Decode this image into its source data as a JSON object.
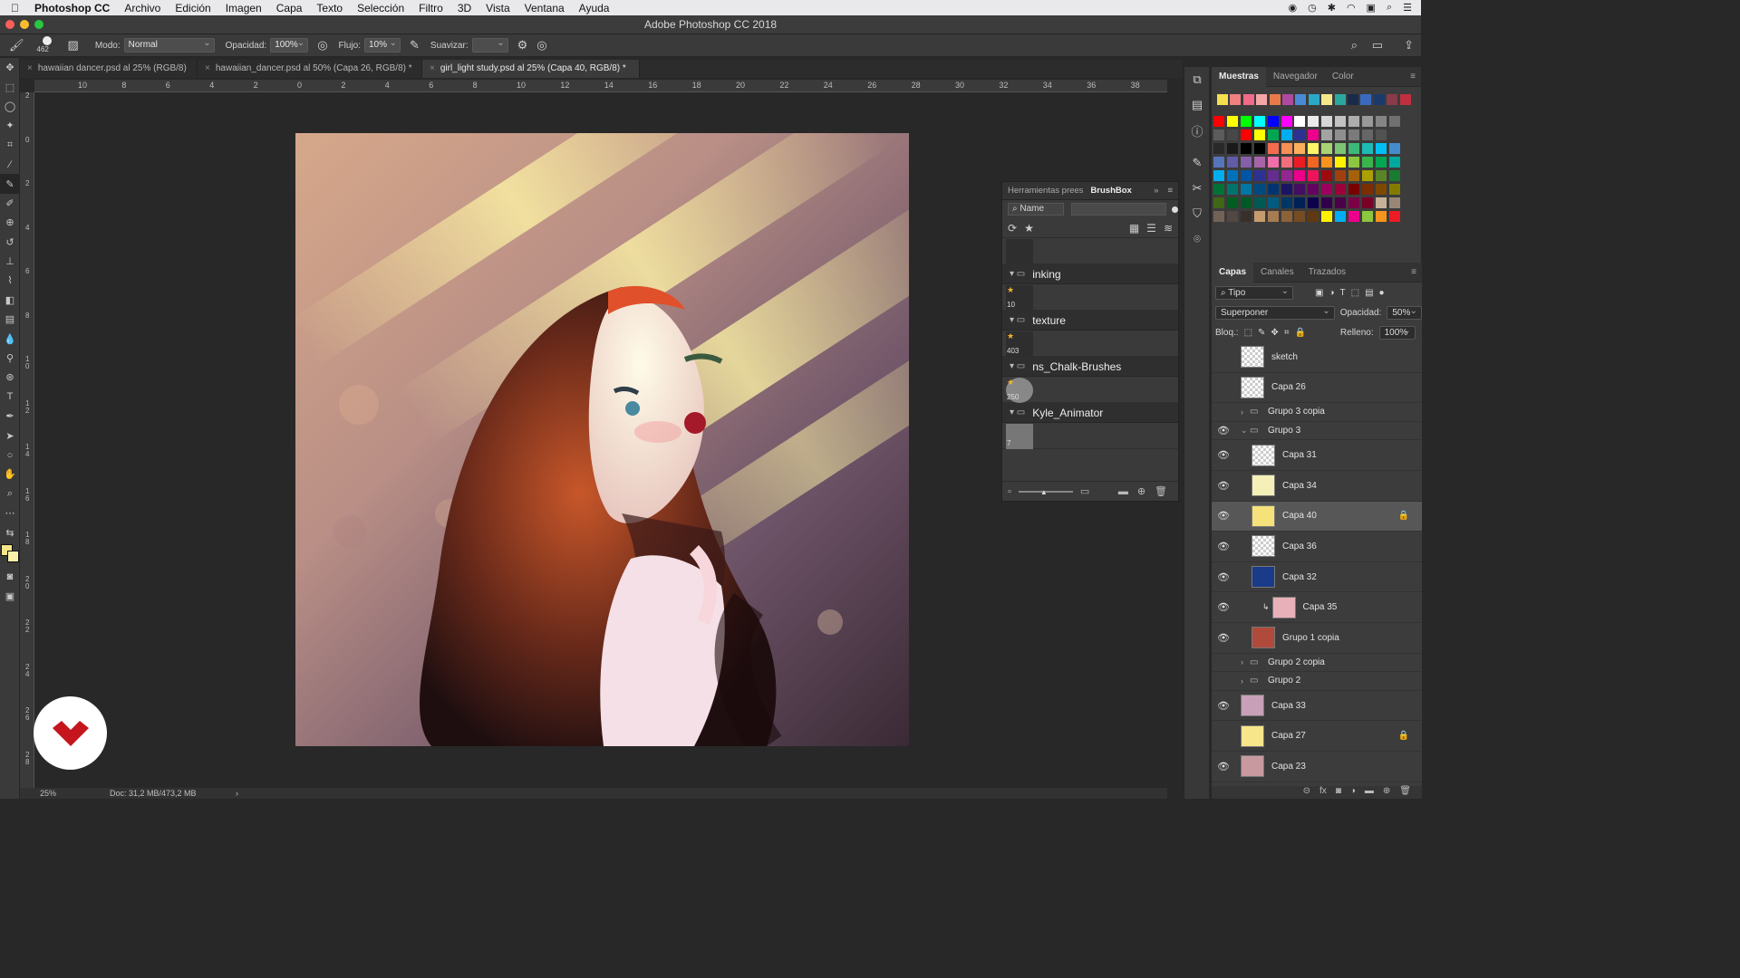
{
  "menubar": {
    "app": "Photoshop CC",
    "items": [
      "Archivo",
      "Edición",
      "Imagen",
      "Capa",
      "Texto",
      "Selección",
      "Filtro",
      "3D",
      "Vista",
      "Ventana",
      "Ayuda"
    ]
  },
  "window": {
    "title": "Adobe Photoshop CC 2018"
  },
  "options": {
    "brush_size": "462",
    "mode_label": "Modo:",
    "mode_value": "Normal",
    "opacity_label": "Opacidad:",
    "opacity_value": "100%",
    "flow_label": "Flujo:",
    "flow_value": "10%",
    "smooth_label": "Suavizar:"
  },
  "tabs": [
    {
      "label": "hawaiian dancer.psd al 25% (RGB/8)"
    },
    {
      "label": "hawaiian_dancer.psd al 50% (Capa 26, RGB/8) *"
    },
    {
      "label": "girl_light study.psd al 25% (Capa 40, RGB/8) *"
    }
  ],
  "ruler": {
    "h_ticks": [
      "10",
      "8",
      "6",
      "4",
      "2",
      "0",
      "2",
      "4",
      "6",
      "8",
      "10",
      "12",
      "14",
      "16",
      "18",
      "20",
      "22",
      "24",
      "26",
      "28",
      "30",
      "32",
      "34",
      "36",
      "38"
    ],
    "v_ticks": [
      "2",
      "0",
      "2",
      "4",
      "6",
      "8",
      "1\n0",
      "1\n2",
      "1\n4",
      "1\n6",
      "1\n8",
      "2\n0",
      "2\n2",
      "2\n4",
      "2\n6",
      "2\n8"
    ]
  },
  "status": {
    "zoom": "25%",
    "doc": "Doc: 31,2 MB/473,2 MB"
  },
  "brushbox": {
    "tab1": "Herramientas prees",
    "tab2": "BrushBox",
    "search_mode": "Name",
    "folders": [
      {
        "name": "inking",
        "count": "10"
      },
      {
        "name": "texture",
        "count": "403"
      },
      {
        "name": "ns_Chalk-Brushes",
        "count": "250"
      },
      {
        "name": "Kyle_Animator",
        "count": "7"
      }
    ]
  },
  "swatch_panel": {
    "tabs": [
      "Muestras",
      "Navegador",
      "Color"
    ],
    "recent": [
      "#f4e04d",
      "#f08080",
      "#f06a8a",
      "#f4a6a6",
      "#e87a4a",
      "#b04aa0",
      "#4a8ad4",
      "#2aa8c8",
      "#f4e88a",
      "#2aa8a0",
      "#1a2a4a",
      "#3a6ac0",
      "#1a3a6a",
      "#8a3a4a",
      "#c03040"
    ],
    "grid": [
      [
        "#ff0000",
        "#ffff00",
        "#00ff00",
        "#00ffff",
        "#0000ff",
        "#ff00ff",
        "#ffffff",
        "#ebebeb",
        "#d6d6d6",
        "#c2c2c2",
        "#adadad",
        "#999999",
        "#858585",
        "#707070"
      ],
      [
        "#5c5c5c",
        "#474747",
        "#ff0000",
        "#ffff00",
        "#00a651",
        "#00aeef",
        "#2e3192",
        "#ec008c",
        "#a3a3a3",
        "#8f8f8f",
        "#7a7a7a",
        "#666666",
        "#525252",
        "#3d3d3d"
      ],
      [
        "#292929",
        "#1a1a1a",
        "#000000",
        "#000000",
        "#f26c4f",
        "#f68e56",
        "#fbaf5d",
        "#fff568",
        "#acd373",
        "#7cc576",
        "#3cb878",
        "#1cbbb4",
        "#00bff3",
        "#448ccb"
      ],
      [
        "#5674b9",
        "#605ca8",
        "#8560a8",
        "#a864a8",
        "#f06eaa",
        "#f26d7d",
        "#ed1c24",
        "#f26522",
        "#f7941d",
        "#fff200",
        "#8dc63f",
        "#39b54a",
        "#00a651",
        "#00a99d"
      ],
      [
        "#00aeef",
        "#0072bc",
        "#0054a6",
        "#2e3192",
        "#662d91",
        "#92278f",
        "#ec008c",
        "#ed145b",
        "#9e0b0f",
        "#a0410d",
        "#a36209",
        "#aba000",
        "#598527",
        "#197b30"
      ],
      [
        "#007236",
        "#00746b",
        "#0076a3",
        "#004a80",
        "#003471",
        "#1b1464",
        "#440e62",
        "#630460",
        "#9e005d",
        "#9e0039",
        "#790000",
        "#7b2e00",
        "#7d4900",
        "#827b00"
      ],
      [
        "#406618",
        "#005e20",
        "#005826",
        "#005952",
        "#005b7f",
        "#003663",
        "#002157",
        "#0d004c",
        "#32004b",
        "#4b0049",
        "#7b0046",
        "#7a0026",
        "#c7b299",
        "#998675"
      ],
      [
        "#736357",
        "#534741",
        "#37302a",
        "#c69c6d",
        "#a67c52",
        "#8c6239",
        "#754c24",
        "#603913",
        "#fff200",
        "#00aeef",
        "#ec008c",
        "#8dc63f",
        "#f7941d",
        "#ed1c24"
      ]
    ]
  },
  "layers_panel": {
    "tabs": [
      "Capas",
      "Canales",
      "Trazados"
    ],
    "filter": "Tipo",
    "blend": "Superponer",
    "opacity_label": "Opacidad:",
    "opacity_value": "50%",
    "lock_label": "Bloq.:",
    "fill_label": "Relleno:",
    "fill_value": "100%",
    "layers": [
      {
        "name": "sketch",
        "visible": false,
        "type": "layer",
        "indent": 0
      },
      {
        "name": "Capa 26",
        "visible": false,
        "type": "layer",
        "indent": 0
      },
      {
        "name": "Grupo 3 copia",
        "visible": false,
        "type": "group",
        "indent": 0
      },
      {
        "name": "Grupo 3",
        "visible": true,
        "type": "group",
        "indent": 0,
        "open": true
      },
      {
        "name": "Capa 31",
        "visible": true,
        "type": "layer",
        "indent": 1
      },
      {
        "name": "Capa 34",
        "visible": true,
        "type": "layer",
        "indent": 1,
        "thumb": "#f4f0b8"
      },
      {
        "name": "Capa 40",
        "visible": true,
        "type": "layer",
        "indent": 1,
        "selected": true,
        "locked": true,
        "thumb": "#f6e27a"
      },
      {
        "name": "Capa 36",
        "visible": true,
        "type": "layer",
        "indent": 1
      },
      {
        "name": "Capa 32",
        "visible": true,
        "type": "layer",
        "indent": 1,
        "thumb": "#1a3a8a"
      },
      {
        "name": "Capa 35",
        "visible": true,
        "type": "layer",
        "indent": 2,
        "thumb": "#e8b0b8"
      },
      {
        "name": "Grupo 1 copia",
        "visible": true,
        "type": "layer",
        "indent": 1,
        "thumb": "#b04a3a"
      },
      {
        "name": "Grupo 2 copia",
        "visible": false,
        "type": "group",
        "indent": 0
      },
      {
        "name": "Grupo 2",
        "visible": false,
        "type": "group",
        "indent": 0
      },
      {
        "name": "Capa 33",
        "visible": true,
        "type": "layer",
        "indent": 0,
        "thumb": "#c8a0b8"
      },
      {
        "name": "Capa 27",
        "visible": false,
        "type": "layer",
        "indent": 0,
        "locked": true,
        "thumb": "#f8e68a"
      },
      {
        "name": "Capa 23",
        "visible": true,
        "type": "layer",
        "indent": 0,
        "thumb": "#c89aa0"
      }
    ]
  }
}
